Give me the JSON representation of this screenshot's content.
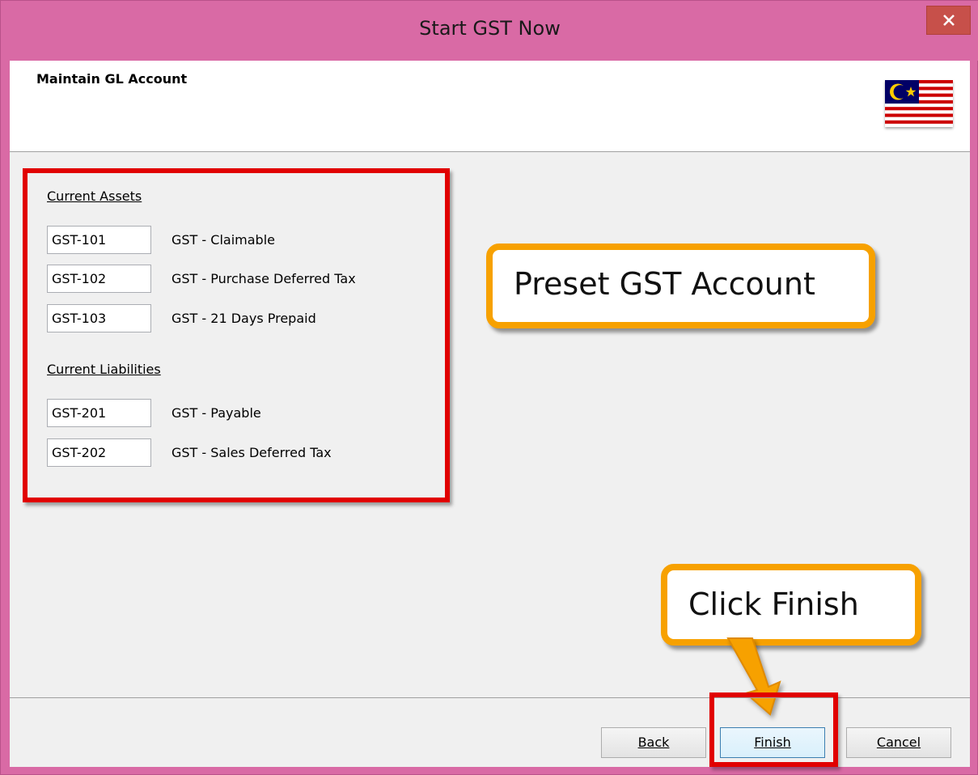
{
  "window": {
    "title": "Start GST Now",
    "close_icon": "close-icon"
  },
  "header": {
    "title": "Maintain GL Account",
    "flag_icon": "malaysia-flag-icon"
  },
  "current_assets": {
    "label": "Current Assets",
    "accounts": [
      {
        "code": "GST-101",
        "name": "GST - Claimable"
      },
      {
        "code": "GST-102",
        "name": "GST - Purchase Deferred Tax"
      },
      {
        "code": "GST-103",
        "name": "GST - 21 Days Prepaid"
      }
    ]
  },
  "current_liabilities": {
    "label": "Current Liabilities",
    "accounts": [
      {
        "code": "GST-201",
        "name": "GST - Payable"
      },
      {
        "code": "GST-202",
        "name": "GST - Sales Deferred Tax"
      }
    ]
  },
  "callouts": {
    "preset": "Preset GST Account",
    "finish": "Click Finish"
  },
  "buttons": {
    "back": "Back",
    "finish": "Finish",
    "cancel": "Cancel"
  },
  "colors": {
    "titlebar": "#d96aa5",
    "highlight_border": "#e10000",
    "callout_border": "#f7a100"
  }
}
